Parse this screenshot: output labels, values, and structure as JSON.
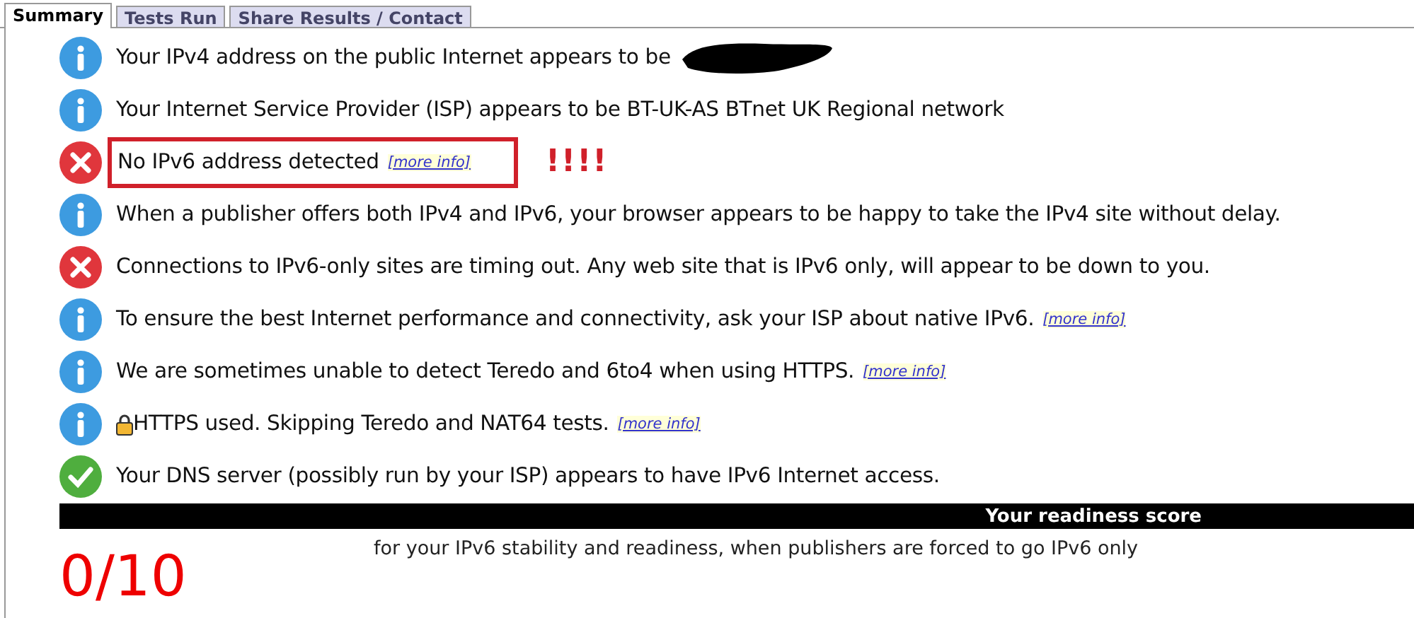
{
  "tabs": [
    {
      "label": "Summary",
      "selected": true
    },
    {
      "label": "Tests Run",
      "selected": false
    },
    {
      "label": "Share Results / Contact",
      "selected": false
    }
  ],
  "results": [
    {
      "kind": "info",
      "text": "Your IPv4 address on the public Internet appears to be",
      "redacted": true
    },
    {
      "kind": "info",
      "text": "Your Internet Service Provider (ISP) appears to be BT-UK-AS BTnet UK Regional network"
    },
    {
      "kind": "error",
      "text": "No IPv6 address detected",
      "link": "[more info]",
      "highlighted": true,
      "note": "!!!!"
    },
    {
      "kind": "info",
      "text": "When a publisher offers both IPv4 and IPv6, your browser appears to be happy to take the IPv4 site without delay."
    },
    {
      "kind": "error",
      "text": "Connections to IPv6-only sites are timing out. Any web site that is IPv6 only, will appear to be down to you."
    },
    {
      "kind": "info",
      "text": "To ensure the best Internet performance and connectivity, ask your ISP about native IPv6.",
      "link": "[more info]"
    },
    {
      "kind": "info",
      "text": "We are sometimes unable to detect Teredo and 6to4 when using HTTPS.",
      "link": "[more info]"
    },
    {
      "kind": "info",
      "text": "HTTPS used. Skipping Teredo and NAT64 tests.",
      "link": "[more info]",
      "lock": true
    },
    {
      "kind": "ok",
      "text": "Your DNS server (possibly run by your ISP) appears to have IPv6 Internet access."
    }
  ],
  "score": {
    "heading": "Your readiness score",
    "value": "0/10",
    "caption": "for your IPv6 stability and readiness, when publishers are forced to go IPv6 only"
  }
}
